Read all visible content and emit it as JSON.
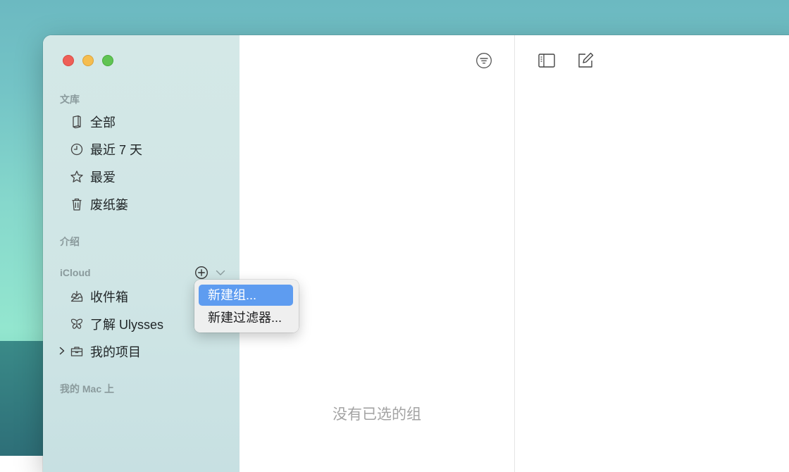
{
  "window": {
    "empty_state_text": "没有已选的组"
  },
  "sidebar": {
    "library_header": "文库",
    "library_items": [
      {
        "label": "全部",
        "icon": "book-icon"
      },
      {
        "label": "最近 7 天",
        "icon": "clock-icon"
      },
      {
        "label": "最爱",
        "icon": "star-icon"
      },
      {
        "label": "废纸篓",
        "icon": "trash-icon"
      }
    ],
    "intro_header": "介绍",
    "icloud_header": "iCloud",
    "icloud_items": [
      {
        "label": "收件箱",
        "icon": "inbox-icon"
      },
      {
        "label": "了解 Ulysses",
        "icon": "butterfly-icon"
      },
      {
        "label": "我的项目",
        "icon": "briefcase-icon"
      }
    ],
    "mac_header": "我的 Mac 上"
  },
  "context_menu": {
    "items": [
      {
        "label": "新建组...",
        "active": true
      },
      {
        "label": "新建过滤器...",
        "active": false
      }
    ]
  },
  "colors": {
    "menu_highlight": "#5e9cf0",
    "traffic_close": "#ee5f57",
    "traffic_minimize": "#f5bd4f",
    "traffic_zoom": "#60c453"
  }
}
